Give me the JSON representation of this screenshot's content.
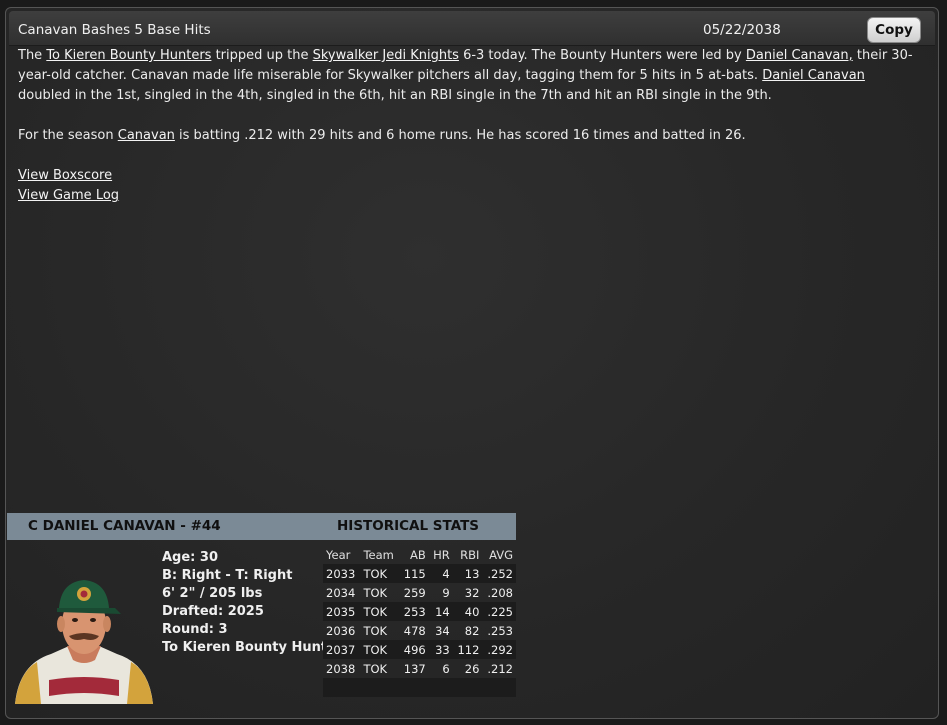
{
  "header": {
    "title": "Canavan Bashes 5 Base Hits",
    "date": "05/22/2038",
    "copy_label": "Copy"
  },
  "article": {
    "p1": {
      "t0": "The ",
      "team1": "To Kieren Bounty Hunters",
      "t1": " tripped up the ",
      "team2": "Skywalker Jedi Knights",
      "t2": " 6-3 today. The Bounty Hunters were led by ",
      "player1": "Daniel Canavan,",
      "t3": " their 30-year-old catcher. Canavan made life miserable for Skywalker pitchers all day, tagging them for 5 hits in 5 at-bats. ",
      "player2": "Daniel Canavan",
      "t4": " doubled in the 1st, singled in the 4th, singled in the 6th, hit an RBI single in the 7th and hit an RBI single in the 9th."
    },
    "p2": {
      "t0": "For the season ",
      "player": "Canavan",
      "t1": " is batting .212 with 29 hits and 6 home runs. He has scored 16 times and batted in 26."
    },
    "links": {
      "boxscore": "View Boxscore",
      "gamelog": "View Game Log"
    }
  },
  "card": {
    "name": "C DANIEL CANAVAN - #44",
    "historical_label": "HISTORICAL STATS",
    "bio": {
      "age": "Age: 30",
      "bats_throws": "B: Right - T: Right",
      "height_weight": "6' 2\" / 205 lbs",
      "drafted": "Drafted: 2025",
      "round": "Round: 3",
      "team": "To Kieren Bounty Hunters"
    },
    "stats": {
      "columns": [
        "Year",
        "Team",
        "AB",
        "HR",
        "RBI",
        "AVG"
      ],
      "rows": [
        [
          "2033",
          "TOK",
          "115",
          "4",
          "13",
          ".252"
        ],
        [
          "2034",
          "TOK",
          "259",
          "9",
          "32",
          ".208"
        ],
        [
          "2035",
          "TOK",
          "253",
          "14",
          "40",
          ".225"
        ],
        [
          "2036",
          "TOK",
          "478",
          "34",
          "82",
          ".253"
        ],
        [
          "2037",
          "TOK",
          "496",
          "33",
          "112",
          ".292"
        ],
        [
          "2038",
          "TOK",
          "137",
          "6",
          "26",
          ".212"
        ]
      ]
    }
  },
  "colors": {
    "card_header": "#7b8a96",
    "window_bg": "#2a2a2a"
  }
}
